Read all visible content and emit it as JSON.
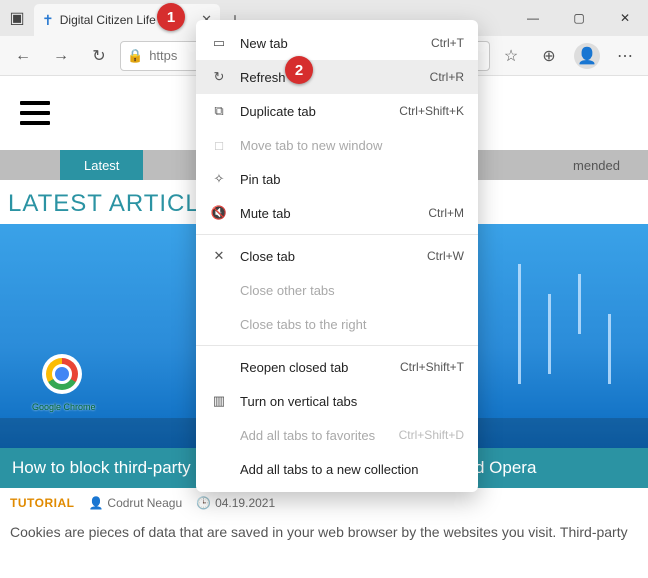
{
  "tab": {
    "title": "Digital Citizen Life"
  },
  "addr": {
    "scheme": "https"
  },
  "pagenav": {
    "pill": "Latest",
    "right": "mended"
  },
  "section_title": "LATEST ARTICLES",
  "chrome_label": "Google Chrome",
  "article": {
    "title": "How to block third-party cookies in Chrome, Firefox, Edge, and Opera",
    "tag": "TUTORIAL",
    "author": "Codrut Neagu",
    "date": "04.19.2021",
    "body": "Cookies are pieces of data that are saved in your web browser by the websites you visit. Third-party"
  },
  "menu": [
    {
      "icon": "▭",
      "label": "New tab",
      "shortcut": "Ctrl+T",
      "enabled": true
    },
    {
      "icon": "↻",
      "label": "Refresh",
      "shortcut": "Ctrl+R",
      "enabled": true,
      "hover": true
    },
    {
      "icon": "⧉",
      "label": "Duplicate tab",
      "shortcut": "Ctrl+Shift+K",
      "enabled": true
    },
    {
      "icon": "□",
      "label": "Move tab to new window",
      "shortcut": "",
      "enabled": false
    },
    {
      "icon": "✧",
      "label": "Pin tab",
      "shortcut": "",
      "enabled": true
    },
    {
      "icon": "🔇",
      "label": "Mute tab",
      "shortcut": "Ctrl+M",
      "enabled": true
    },
    {
      "sep": true
    },
    {
      "icon": "✕",
      "label": "Close tab",
      "shortcut": "Ctrl+W",
      "enabled": true
    },
    {
      "icon": "",
      "label": "Close other tabs",
      "shortcut": "",
      "enabled": false
    },
    {
      "icon": "",
      "label": "Close tabs to the right",
      "shortcut": "",
      "enabled": false
    },
    {
      "sep": true
    },
    {
      "icon": "",
      "label": "Reopen closed tab",
      "shortcut": "Ctrl+Shift+T",
      "enabled": true
    },
    {
      "icon": "▥",
      "label": "Turn on vertical tabs",
      "shortcut": "",
      "enabled": true
    },
    {
      "icon": "",
      "label": "Add all tabs to favorites",
      "shortcut": "Ctrl+Shift+D",
      "enabled": false
    },
    {
      "icon": "",
      "label": "Add all tabs to a new collection",
      "shortcut": "",
      "enabled": true
    }
  ],
  "callouts": {
    "one": "1",
    "two": "2"
  }
}
